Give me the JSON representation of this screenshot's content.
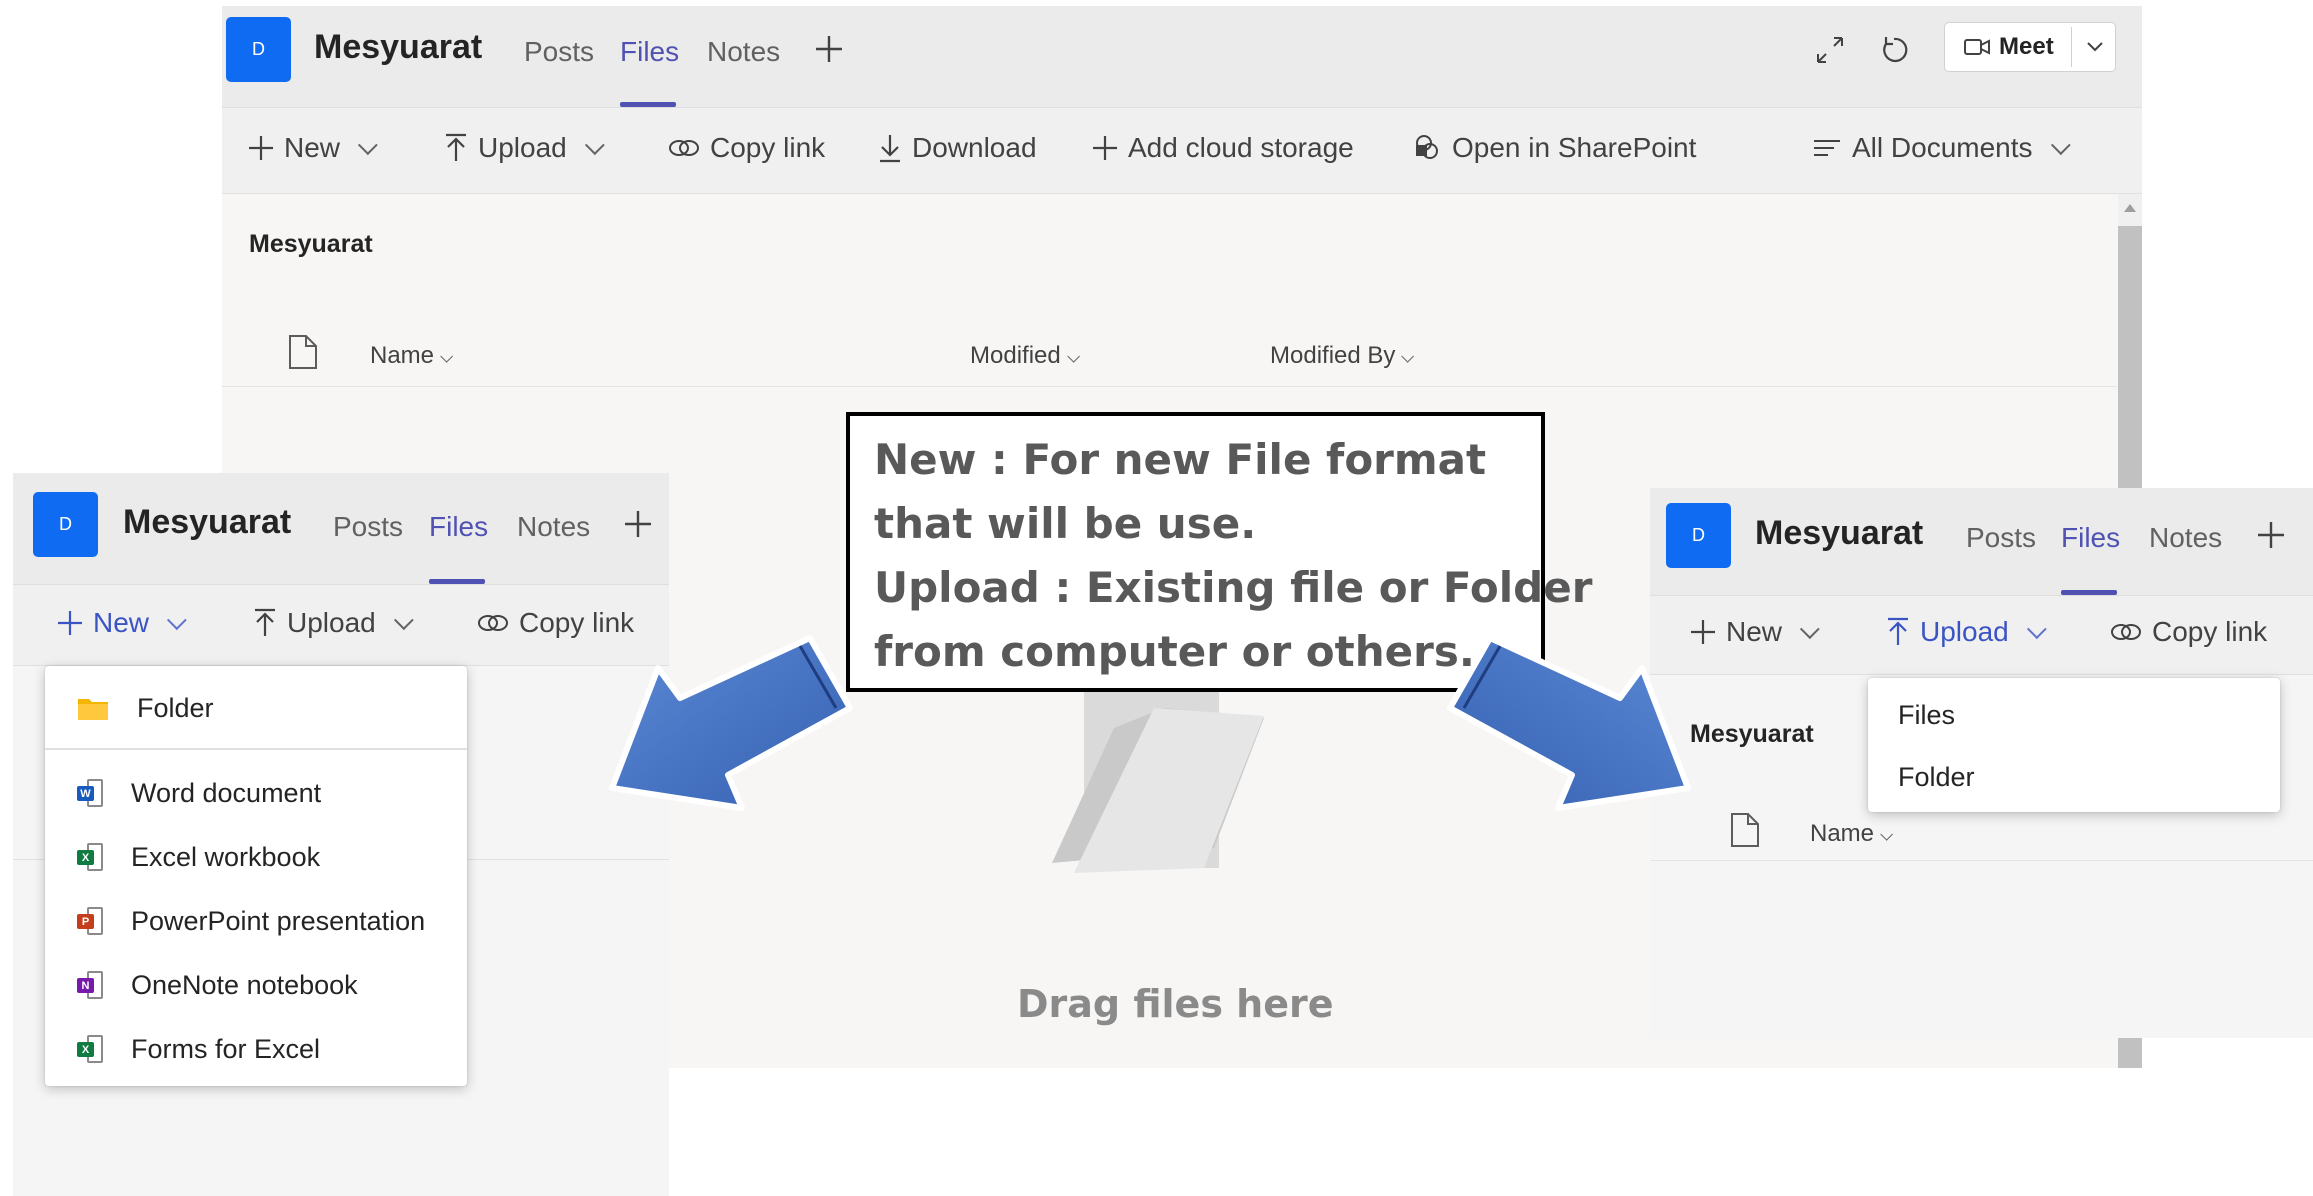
{
  "main": {
    "avatar": "D",
    "team": "Mesyuarat",
    "tabs": [
      "Posts",
      "Files",
      "Notes"
    ],
    "toolbar": {
      "new": "New",
      "upload": "Upload",
      "copy_link": "Copy link",
      "download": "Download",
      "add_cloud": "Add cloud storage",
      "open_sharepoint": "Open in SharePoint",
      "view": "All Documents"
    },
    "meet": "Meet",
    "breadcrumb": "Mesyuarat",
    "columns": {
      "name": "Name",
      "modified": "Modified",
      "modified_by": "Modified By"
    },
    "empty_text": "Drag files here"
  },
  "left": {
    "avatar": "D",
    "team": "Mesyuarat",
    "tabs": [
      "Posts",
      "Files",
      "Notes"
    ],
    "toolbar": {
      "new": "New",
      "upload": "Upload",
      "copy_link": "Copy link"
    },
    "menu": [
      {
        "label": "Folder",
        "icon": "folder-icon"
      },
      {
        "label": "Word document",
        "icon": "word-icon",
        "badge": "W",
        "color": "#185abd"
      },
      {
        "label": "Excel workbook",
        "icon": "excel-icon",
        "badge": "X",
        "color": "#107c41"
      },
      {
        "label": "PowerPoint presentation",
        "icon": "powerpoint-icon",
        "badge": "P",
        "color": "#c43e1c"
      },
      {
        "label": "OneNote notebook",
        "icon": "onenote-icon",
        "badge": "N",
        "color": "#7719aa"
      },
      {
        "label": "Forms for Excel",
        "icon": "forms-excel-icon",
        "badge": "X",
        "color": "#107c41"
      }
    ]
  },
  "right": {
    "avatar": "D",
    "team": "Mesyuarat",
    "tabs": [
      "Posts",
      "Files",
      "Notes"
    ],
    "toolbar": {
      "new": "New",
      "upload": "Upload",
      "copy_link": "Copy link"
    },
    "breadcrumb": "Mesyuarat",
    "column_name": "Name",
    "menu": [
      "Files",
      "Folder"
    ]
  },
  "callout": {
    "lines": [
      "New : For new File format",
      "that will be use.",
      "Upload : Existing file or Folder",
      "from computer or others."
    ]
  },
  "colors": {
    "accent": "#4f52b2",
    "avatar": "#0f6cf2",
    "arrow": "#4472c4"
  }
}
